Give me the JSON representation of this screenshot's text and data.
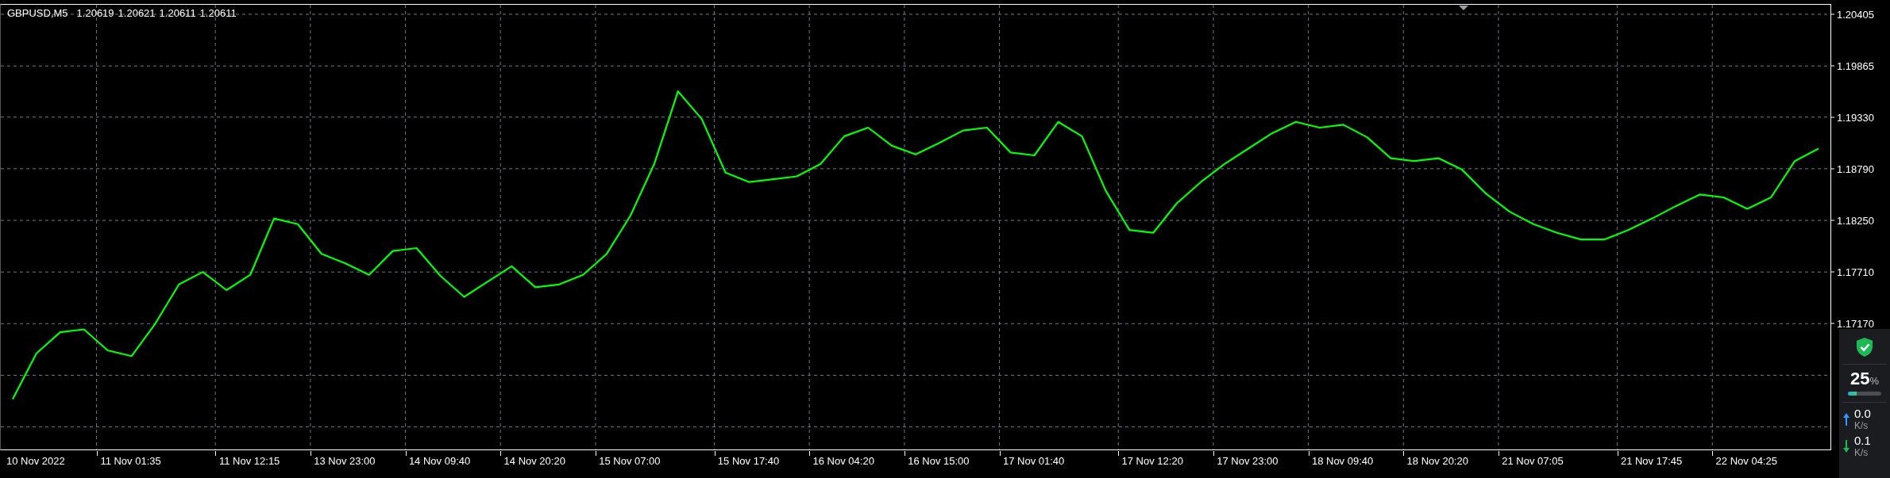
{
  "chart_header": {
    "prices": [
      "1.20619",
      "1.20621",
      "1.20611",
      "1.20611"
    ]
  },
  "chart_data": {
    "type": "line",
    "ylim": [
      1.15854,
      1.20505
    ],
    "categories": [
      null,
      "10 Nov 2022",
      null,
      null,
      null,
      "11 Nov 01:35",
      null,
      null,
      null,
      null,
      "11 Nov 12:15",
      null,
      null,
      null,
      "13 Nov 23:00",
      null,
      null,
      null,
      "14 Nov 09:40",
      null,
      null,
      null,
      "14 Nov 20:20",
      null,
      null,
      null,
      "15 Nov 07:00",
      null,
      null,
      null,
      null,
      "15 Nov 17:40",
      null,
      null,
      null,
      "16 Nov 04:20",
      null,
      null,
      null,
      "16 Nov 15:00",
      null,
      null,
      null,
      "17 Nov 01:40",
      null,
      null,
      null,
      null,
      "17 Nov 12:20",
      null,
      null,
      null,
      "17 Nov 23:00",
      null,
      null,
      null,
      "18 Nov 09:40",
      null,
      null,
      null,
      "18 Nov 20:20",
      null,
      null,
      null,
      "21 Nov 07:05",
      null,
      null,
      null,
      null,
      "21 Nov 17:45",
      null,
      null,
      null,
      "22 Nov 04:25",
      null,
      null,
      null
    ],
    "series": [
      {
        "name": "GBPUSD,M5",
        "color": "#00ff00",
        "values": [
          1.1638,
          1.1686,
          1.1708,
          1.1711,
          1.1689,
          1.1683,
          1.1717,
          1.1758,
          1.1771,
          1.1752,
          1.1768,
          1.1827,
          1.1821,
          1.179,
          1.178,
          1.1768,
          1.1793,
          1.1796,
          1.1767,
          1.1745,
          1.1761,
          1.1777,
          1.1755,
          1.1758,
          1.1768,
          1.179,
          1.183,
          1.1884,
          1.196,
          1.1931,
          1.1875,
          1.1865,
          1.1868,
          1.1871,
          1.1884,
          1.1913,
          1.1922,
          1.1903,
          1.1894,
          1.1906,
          1.1919,
          1.1922,
          1.1896,
          1.1893,
          1.1928,
          1.1913,
          1.1856,
          1.1815,
          1.1812,
          1.1843,
          1.1865,
          1.1884,
          1.19,
          1.1916,
          1.1928,
          1.1922,
          1.1925,
          1.1912,
          1.189,
          1.1887,
          1.189,
          1.1878,
          1.1853,
          1.1834,
          1.1821,
          1.1812,
          1.1805,
          1.1805,
          1.1815,
          1.1827,
          1.184,
          1.1852,
          1.1849,
          1.1837,
          1.1849,
          1.1887,
          1.19
        ]
      }
    ],
    "grid": true,
    "yticks": [
      {
        "value": 1.20405,
        "label": "1.20405"
      },
      {
        "value": 1.19865,
        "label": "1.19865"
      },
      {
        "value": 1.1933,
        "label": "1.19330"
      },
      {
        "value": 1.1879,
        "label": "1.18790"
      },
      {
        "value": 1.1825,
        "label": "1.18250"
      },
      {
        "value": 1.1771,
        "label": "1.17710"
      },
      {
        "value": 1.1717,
        "label": "1.17170"
      }
    ]
  },
  "network_monitor": {
    "percent": "25",
    "percent_sign": "%",
    "level": 0.25,
    "rates": [
      {
        "kind": "upload",
        "value": "0.0",
        "unit": "K/s"
      },
      {
        "kind": "download",
        "value": "0.1",
        "unit": "K/s"
      }
    ]
  }
}
